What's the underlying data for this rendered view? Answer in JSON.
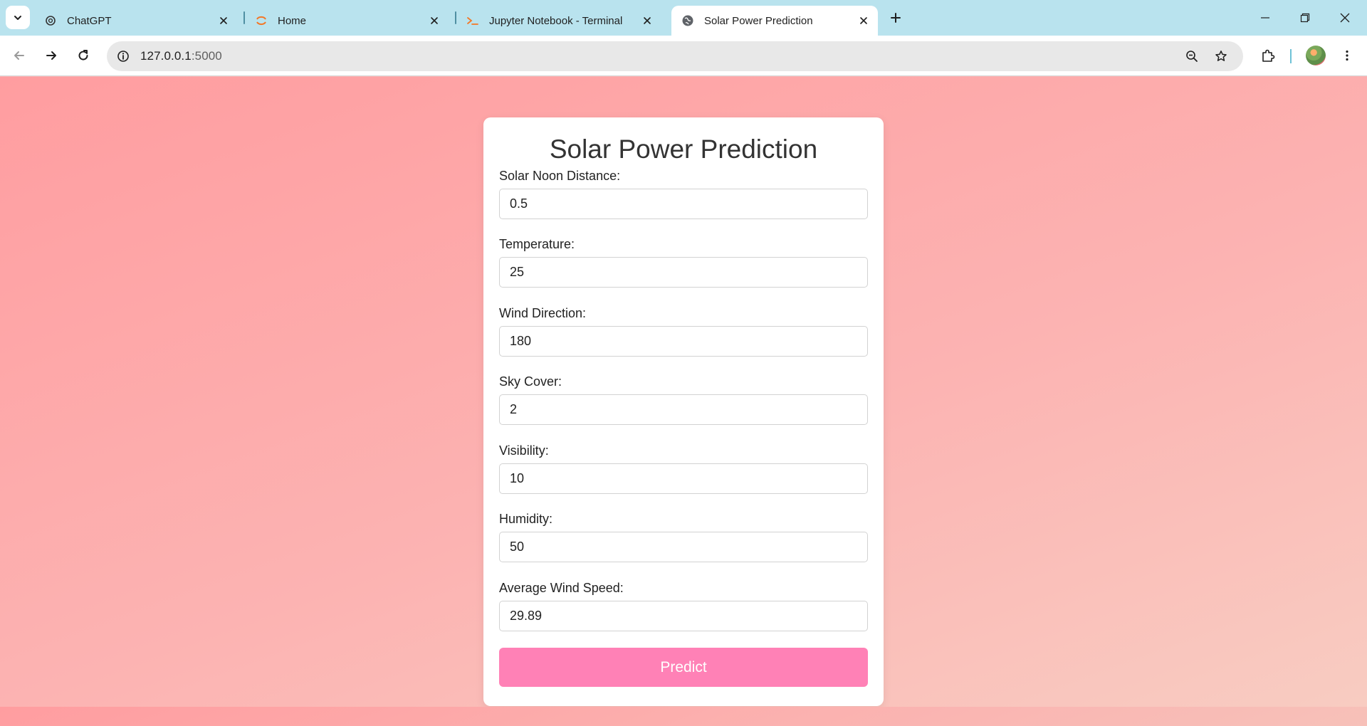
{
  "browser": {
    "tabs": [
      {
        "label": "ChatGPT",
        "icon": "chatgpt-icon"
      },
      {
        "label": "Home",
        "icon": "jupyter-icon"
      },
      {
        "label": "Jupyter Notebook - Terminal",
        "icon": "terminal-icon"
      },
      {
        "label": "Solar Power Prediction",
        "icon": "globe-icon"
      }
    ],
    "active_tab": 3,
    "url_host": "127.0.0.1",
    "url_port": ":5000"
  },
  "page": {
    "title": "Solar Power Prediction",
    "fields": [
      {
        "label": "Solar Noon Distance:",
        "value": "0.5"
      },
      {
        "label": "Temperature:",
        "value": "25"
      },
      {
        "label": "Wind Direction:",
        "value": "180"
      },
      {
        "label": "Sky Cover:",
        "value": "2"
      },
      {
        "label": "Visibility:",
        "value": "10"
      },
      {
        "label": "Humidity:",
        "value": "50"
      },
      {
        "label": "Average Wind Speed:",
        "value": "29.89"
      }
    ],
    "submit_label": "Predict"
  },
  "colors": {
    "tabstrip": "#b9e3ee",
    "button": "#ff81b6",
    "background_start": "#ff9da0",
    "background_end": "#f8cdc2"
  }
}
